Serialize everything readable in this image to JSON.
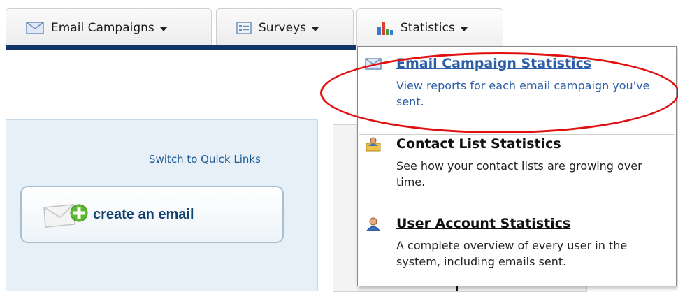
{
  "tabs": [
    {
      "label": "Email Campaigns",
      "icon": "envelope-icon"
    },
    {
      "label": "Surveys",
      "icon": "survey-form-icon"
    },
    {
      "label": "Statistics",
      "icon": "bar-chart-icon"
    }
  ],
  "panel": {
    "quick_links": "Switch to Quick Links",
    "create_label": "create an email"
  },
  "dropdown": {
    "items": [
      {
        "title": "Email Campaign Statistics",
        "desc": "View reports for each email campaign you've sent.",
        "icon": "envelope-icon"
      },
      {
        "title": "Contact List Statistics",
        "desc": "See how your contact lists are growing over time.",
        "icon": "contact-list-icon"
      },
      {
        "title": "User Account Statistics",
        "desc": "A complete overview of every user in the system, including emails sent.",
        "icon": "user-icon"
      }
    ]
  },
  "colors": {
    "nav_bar": "#0f3666",
    "highlight_link": "#2d5fa8",
    "annotation_circle": "#e01010",
    "panel_bg": "#e6f0f6"
  }
}
